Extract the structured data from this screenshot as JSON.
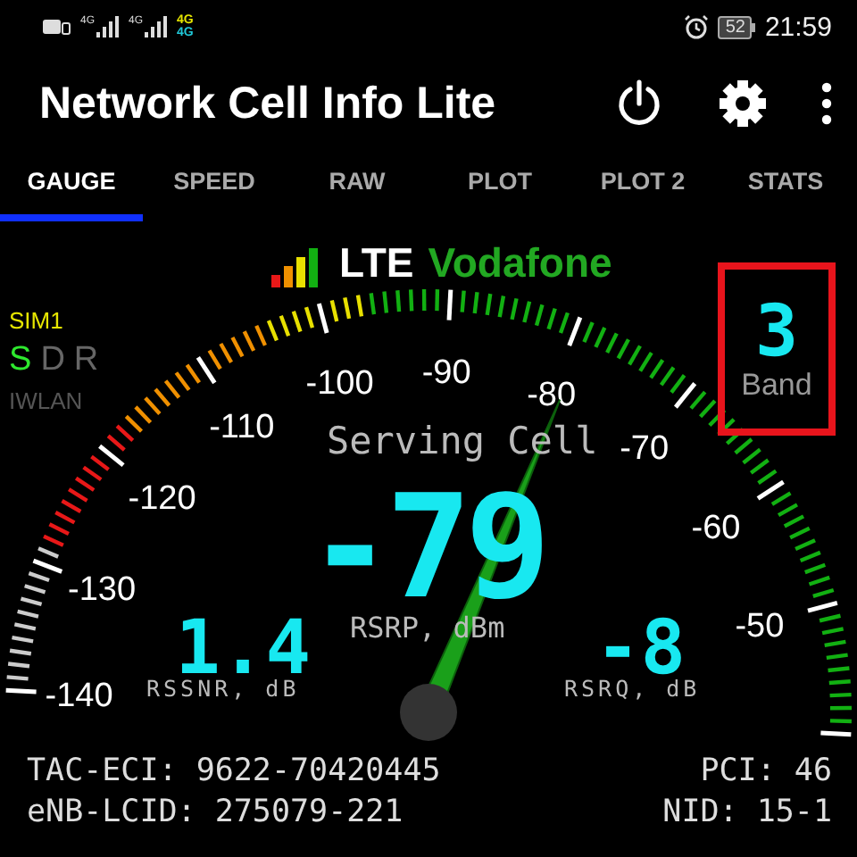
{
  "status_bar": {
    "signal_labels": [
      "4G",
      "4G"
    ],
    "network_badge": [
      {
        "label": "4G",
        "color": "#e6e600"
      },
      {
        "label": "4G",
        "color": "#20c8d8"
      }
    ],
    "battery": "52",
    "time": "21:59"
  },
  "app_bar": {
    "title": "Network Cell Info Lite"
  },
  "tabs": [
    {
      "label": "GAUGE",
      "selected": true
    },
    {
      "label": "SPEED",
      "selected": false
    },
    {
      "label": "RAW",
      "selected": false
    },
    {
      "label": "PLOT",
      "selected": false
    },
    {
      "label": "PLOT 2",
      "selected": false
    },
    {
      "label": "STATS",
      "selected": false
    }
  ],
  "operator": {
    "technology": "LTE",
    "name": "Vodafone"
  },
  "sim": {
    "label": "SIM1",
    "indicators": [
      {
        "label": "S",
        "active": true
      },
      {
        "label": "D",
        "active": false
      },
      {
        "label": "R",
        "active": false
      }
    ],
    "iwlan": "IWLAN"
  },
  "gauge": {
    "tick_labels": [
      "-140",
      "-130",
      "-120",
      "-110",
      "-100",
      "-90",
      "-80",
      "-70",
      "-60",
      "-50"
    ],
    "title": "Serving Cell",
    "value": "-79",
    "unit": "RSRP, dBm"
  },
  "rssnr": {
    "value": "1.4",
    "label": "RSSNR, dB"
  },
  "rsrq": {
    "value": "-8",
    "label": "RSRQ, dB"
  },
  "band": {
    "value": "3",
    "label": "Band"
  },
  "info": {
    "left": [
      "TAC-ECI: 9622-70420445",
      "eNB-LCID: 275079-221"
    ],
    "right": [
      "PCI: 46",
      "NID: 15-1"
    ]
  }
}
